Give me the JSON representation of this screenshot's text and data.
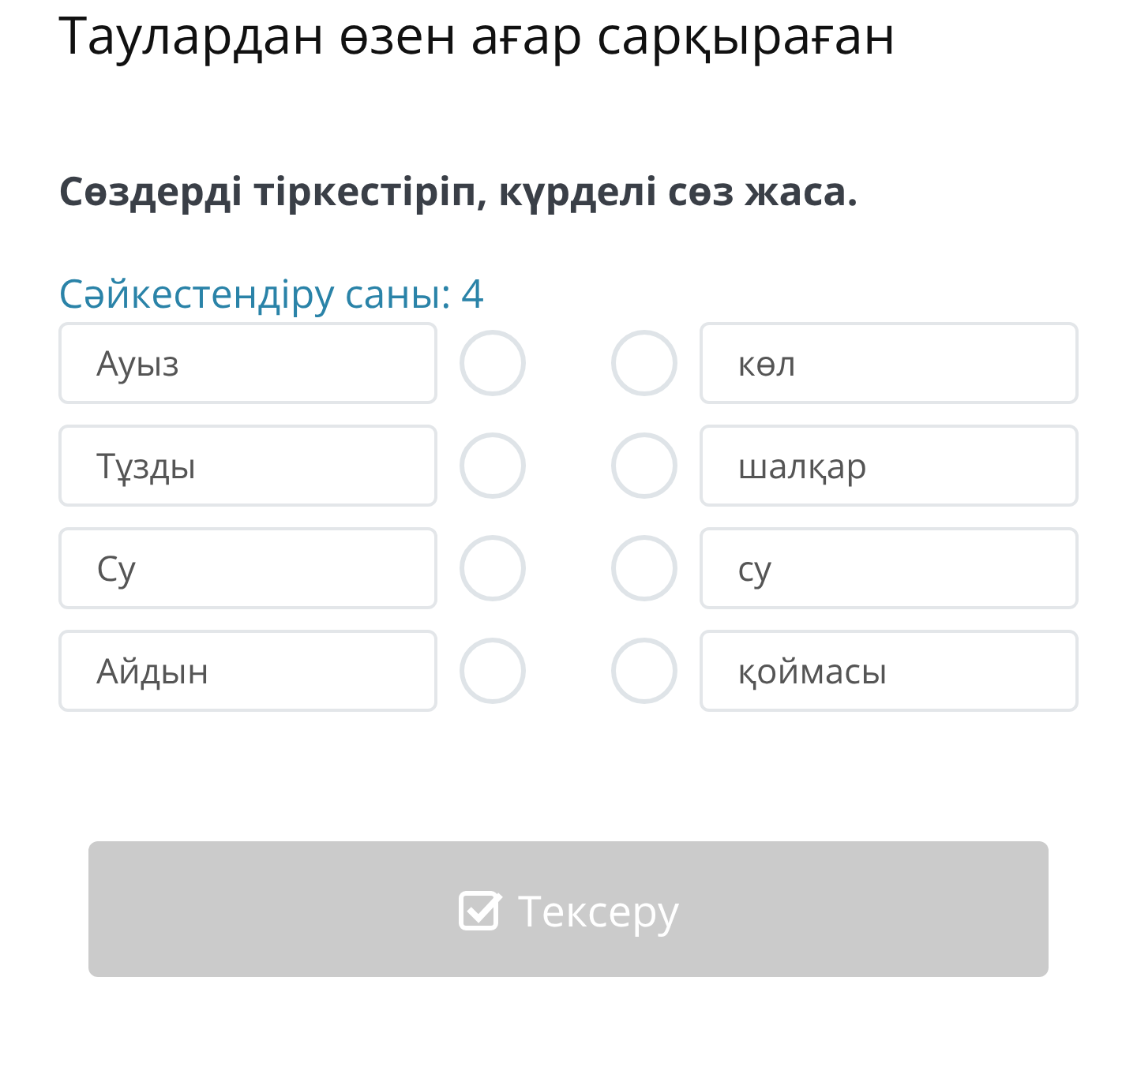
{
  "title": "Таулардан өзен ағар сарқыраған",
  "instruction": "Сөздерді тіркестіріп, күрделі сөз жаса.",
  "match_count": "Сәйкестендіру саны: 4",
  "left_items": [
    {
      "label": "Ауыз"
    },
    {
      "label": "Тұзды"
    },
    {
      "label": "Су"
    },
    {
      "label": "Айдын"
    }
  ],
  "right_items": [
    {
      "label": "көл"
    },
    {
      "label": "шалқар"
    },
    {
      "label": "су"
    },
    {
      "label": "қоймасы"
    }
  ],
  "check_button": {
    "label": "Тексеру",
    "disabled": true
  }
}
